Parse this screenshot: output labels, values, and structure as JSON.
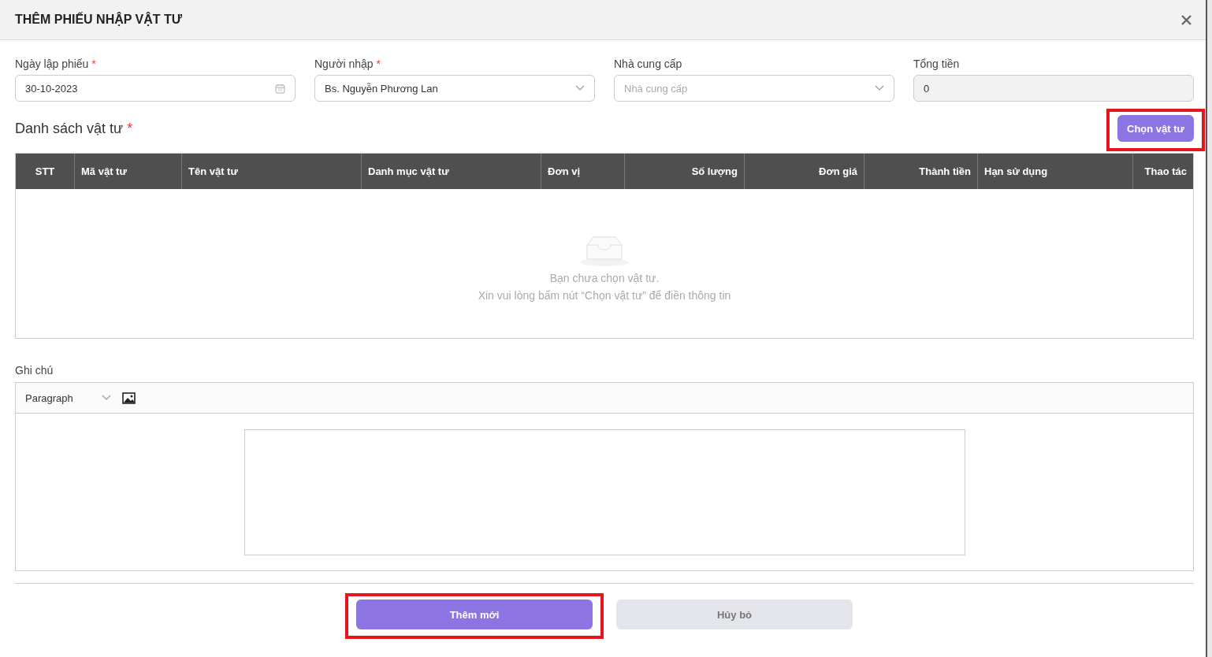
{
  "dialog": {
    "title": "THÊM PHIẾU NHẬP VẬT TƯ"
  },
  "fields": [
    {
      "kind": "date",
      "label": "Ngày lập phiếu",
      "required_mark": "*",
      "value": "30-10-2023"
    },
    {
      "kind": "select",
      "label": "Người nhập",
      "required_mark": "*",
      "value": "Bs. Nguyễn Phương Lan"
    },
    {
      "kind": "select",
      "label": "Nhà cung cấp",
      "placeholder": "Nhà cung cấp"
    },
    {
      "kind": "readonly",
      "label": "Tổng tiền",
      "value": "0"
    }
  ],
  "materials": {
    "title": "Danh sách vật tư",
    "required_mark": "*",
    "choose_button": {
      "label": "Chọn vật tư",
      "highlighted": true
    },
    "columns": [
      "STT",
      "Mã vật tư",
      "Tên vật tư",
      "Danh mục vật tư",
      "Đơn vị",
      "Số lượng",
      "Đơn giá",
      "Thành tiền",
      "Hạn sử dụng",
      "Thao tác"
    ],
    "empty_lines": [
      "Bạn chưa chọn vật tư.",
      "Xin vui lòng bấm nút “Chọn vật tư” để điền thông tin"
    ]
  },
  "note": {
    "label": "Ghi chú",
    "format": "Paragraph"
  },
  "buttons": [
    {
      "kind": "primary",
      "label": "Thêm mới",
      "highlighted": true
    },
    {
      "kind": "secondary",
      "label": "Hủy bỏ",
      "highlighted": false
    }
  ]
}
